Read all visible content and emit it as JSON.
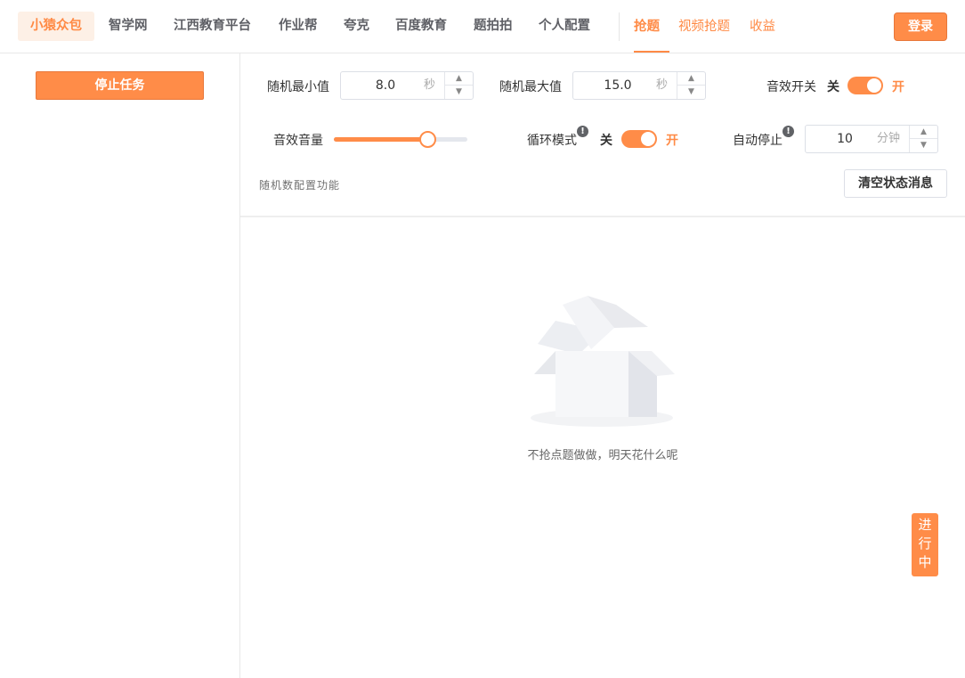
{
  "nav": {
    "items": [
      "小猿众包",
      "智学网",
      "江西教育平台",
      "作业帮",
      "夸克",
      "百度教育",
      "题拍拍",
      "个人配置"
    ],
    "active_index": 0
  },
  "tabs": {
    "items": [
      "抢题",
      "视频抢题",
      "收益"
    ],
    "active_index": 0
  },
  "header": {
    "login_label": "登录"
  },
  "sidebar": {
    "stop_label": "停止任务"
  },
  "config": {
    "rand_min": {
      "label": "随机最小值",
      "value": "8.0",
      "unit": "秒"
    },
    "rand_max": {
      "label": "随机最大值",
      "value": "15.0",
      "unit": "秒"
    },
    "sound_switch": {
      "label": "音效开关",
      "off_label": "关",
      "on_label": "开",
      "state": "on"
    },
    "volume": {
      "label": "音效音量",
      "level_percent": 70
    },
    "loop_mode": {
      "label": "循环模式",
      "off_label": "关",
      "on_label": "开",
      "state": "on",
      "info_glyph": "!"
    },
    "auto_stop": {
      "label": "自动停止",
      "value": "10",
      "unit": "分钟",
      "info_glyph": "!"
    },
    "hint": "随机数配置功能",
    "clear_label": "清空状态消息"
  },
  "empty": {
    "text": "不抢点题做做，明天花什么呢"
  },
  "status_badge": {
    "chars": [
      "进",
      "行",
      "中"
    ]
  },
  "colors": {
    "accent": "#ff8c48",
    "accent_text": "#ff8a45"
  },
  "icons": {
    "spin_up": "▲",
    "spin_down": "▼",
    "empty_illustration": "empty-box-icon",
    "info": "info-icon"
  }
}
